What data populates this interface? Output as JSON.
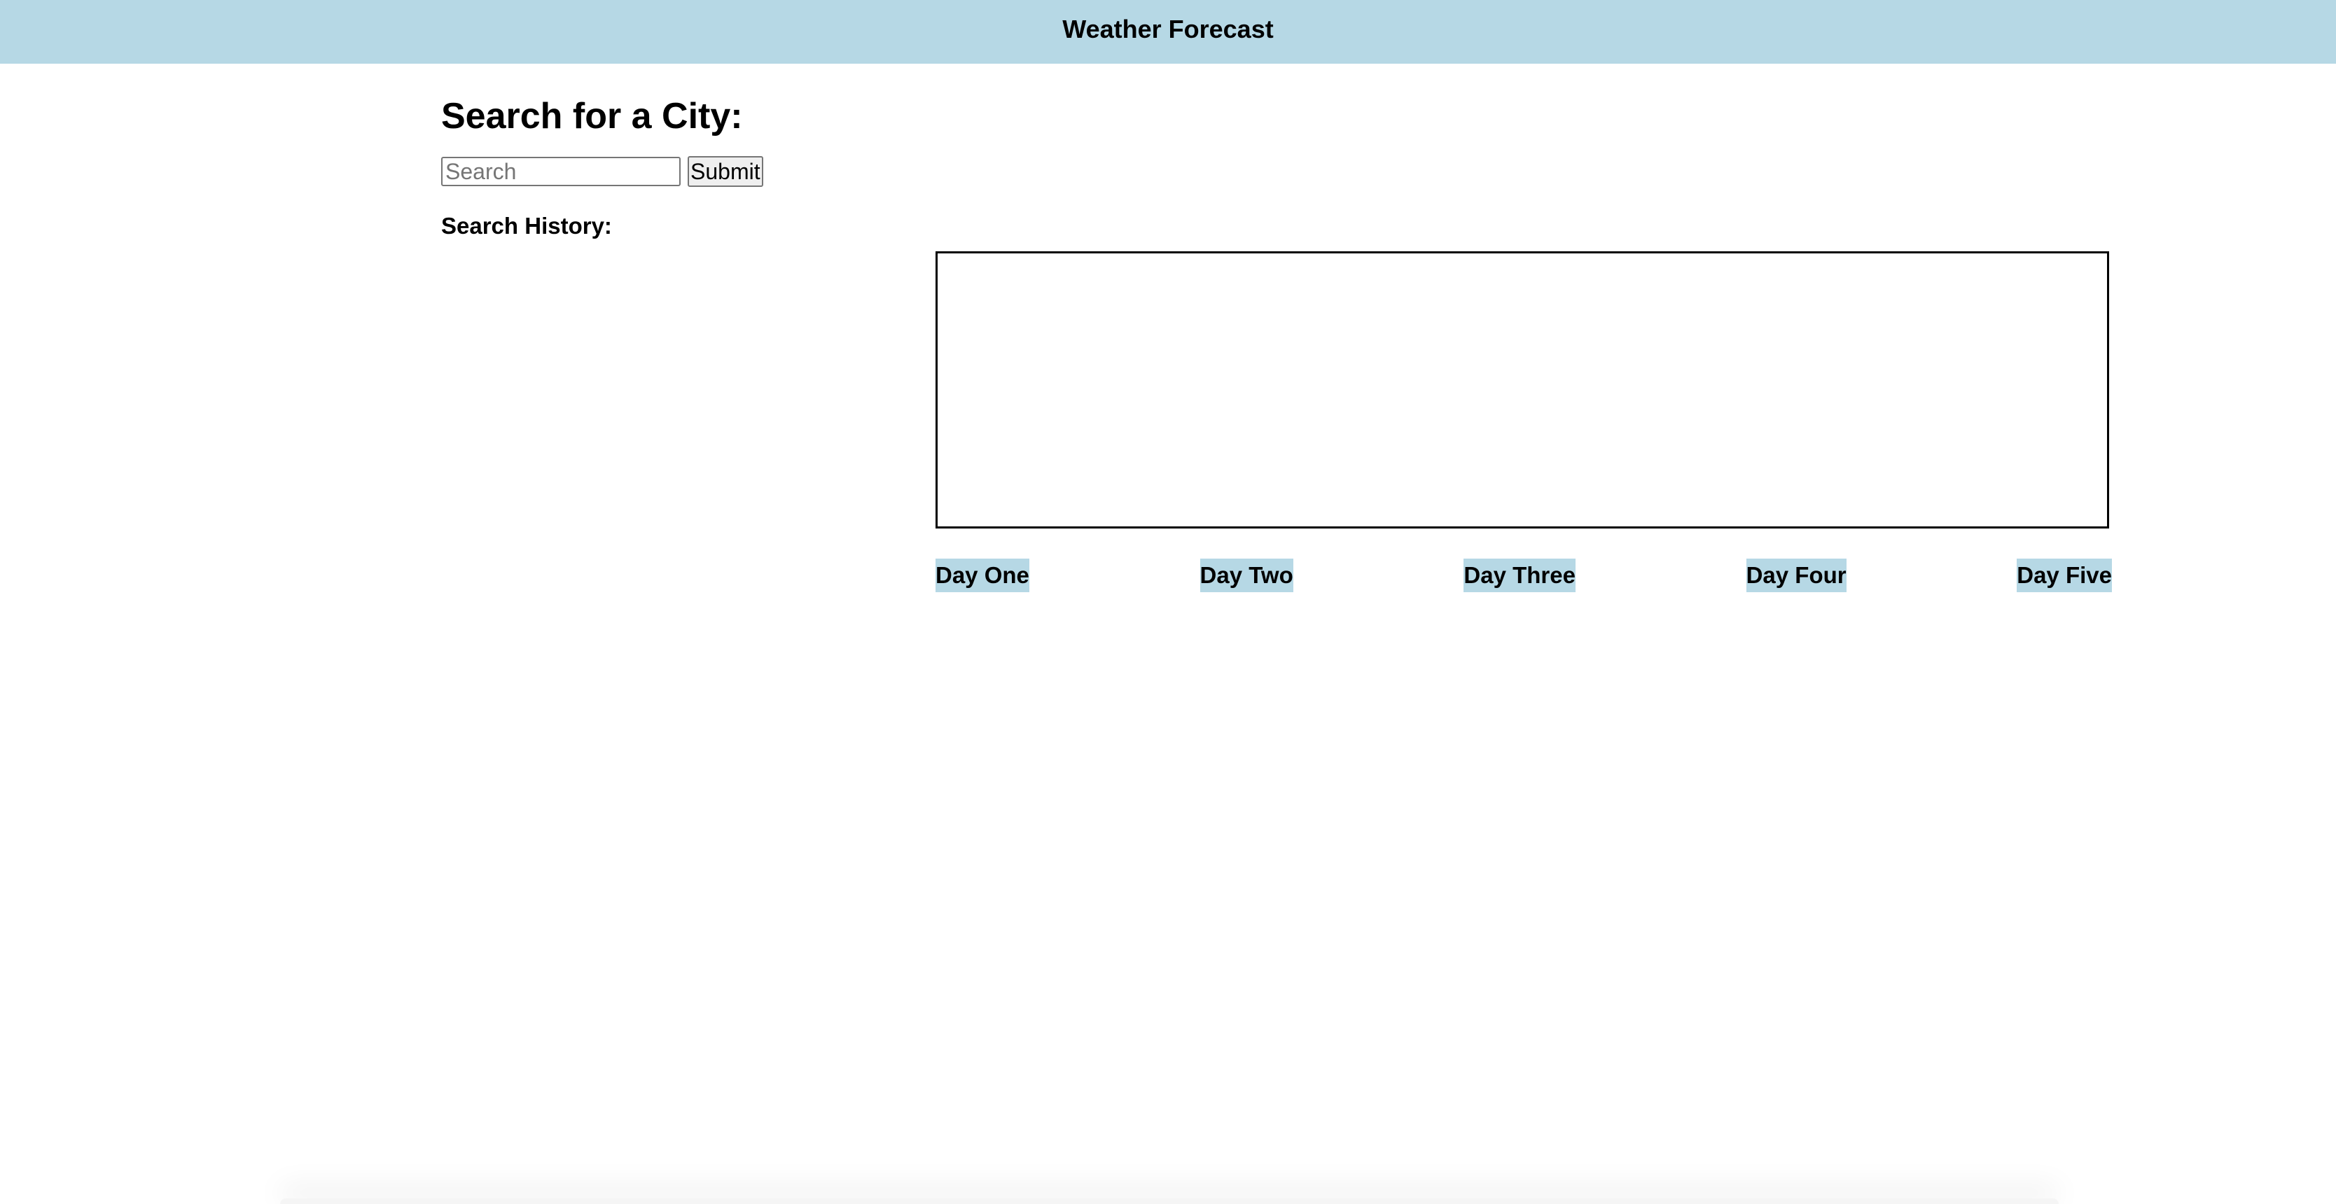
{
  "header": {
    "title": "Weather Forecast"
  },
  "search": {
    "heading": "Search for a City:",
    "input_value": "",
    "placeholder": "Search",
    "submit_label": "Submit"
  },
  "history": {
    "label": "Search History:",
    "items": []
  },
  "forecast": {
    "days": [
      {
        "label": "Day One"
      },
      {
        "label": "Day Two"
      },
      {
        "label": "Day Three"
      },
      {
        "label": "Day Four"
      },
      {
        "label": "Day Five"
      }
    ]
  },
  "colors": {
    "accent": "#b6d8e5",
    "text": "#000000",
    "background": "#ffffff"
  }
}
